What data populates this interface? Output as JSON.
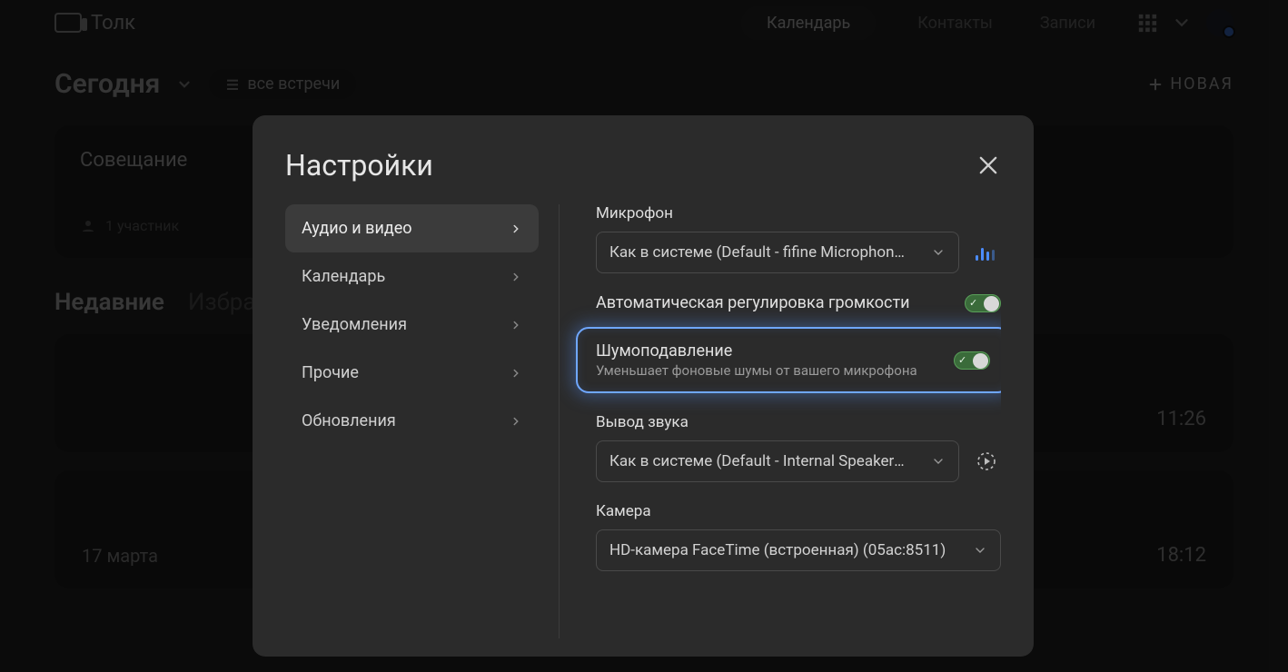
{
  "app": {
    "name": "Толк",
    "nav": {
      "calendar": "Календарь",
      "contacts": "Контакты",
      "records": "Записи"
    },
    "new_button": "НОВАЯ"
  },
  "page": {
    "today": "Сегодня",
    "all_meetings": "все встречи",
    "meeting_card_title": "Совещание",
    "participants": "1 участник",
    "tabs": {
      "recent": "Недавние",
      "favorites": "Избранные"
    },
    "rows": [
      {
        "date": "",
        "time": "11:26"
      },
      {
        "date": "17 марта",
        "time": "18:12"
      }
    ]
  },
  "settings": {
    "title": "Настройки",
    "menu": {
      "audio_video": "Аудио и видео",
      "calendar": "Календарь",
      "notifications": "Уведомления",
      "other": "Прочие",
      "updates": "Обновления"
    },
    "mic": {
      "label": "Микрофон",
      "value": "Как в системе (Default - fifine Microphone (…"
    },
    "auto_gain": {
      "label": "Автоматическая регулировка громкости"
    },
    "noise": {
      "label": "Шумоподавление",
      "sub": "Уменьшает фоновые шумы от вашего микрофона"
    },
    "output": {
      "label": "Вывод звука",
      "value": "Как в системе (Default - Internal Speakers (…"
    },
    "camera": {
      "label": "Камера",
      "value": "HD-камера FaceTime (встроенная) (05ac:8511)"
    }
  }
}
